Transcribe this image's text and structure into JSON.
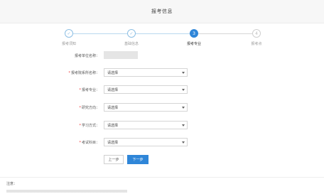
{
  "header": {
    "title": "报考信息"
  },
  "steps": [
    {
      "label": "报考须知",
      "icon": "check-icon",
      "glyph": "✓",
      "state": "done"
    },
    {
      "label": "基础信息",
      "icon": "check-icon",
      "glyph": "✓",
      "state": "done"
    },
    {
      "label": "报考专业",
      "icon": "step-number",
      "glyph": "3",
      "state": "active"
    },
    {
      "label": "报考点",
      "icon": "step-number",
      "glyph": "4",
      "state": "todo"
    }
  ],
  "form": {
    "unit_label": "报考单位名称：",
    "fields": [
      {
        "label": "报考院系所名称：",
        "required": true,
        "value": "请选择"
      },
      {
        "label": "报考专业：",
        "required": true,
        "value": "请选择"
      },
      {
        "label": "研究方向：",
        "required": true,
        "value": "请选择"
      },
      {
        "label": "学习方式：",
        "required": true,
        "value": "请选择"
      },
      {
        "label": "考试科目：",
        "required": true,
        "value": "请选择"
      }
    ],
    "prev_label": "上一步",
    "next_label": "下一步"
  },
  "notice": {
    "title": "注意："
  },
  "colors": {
    "primary": "#2f86d8",
    "required": "#e33333",
    "done": "#8dbfe4"
  }
}
